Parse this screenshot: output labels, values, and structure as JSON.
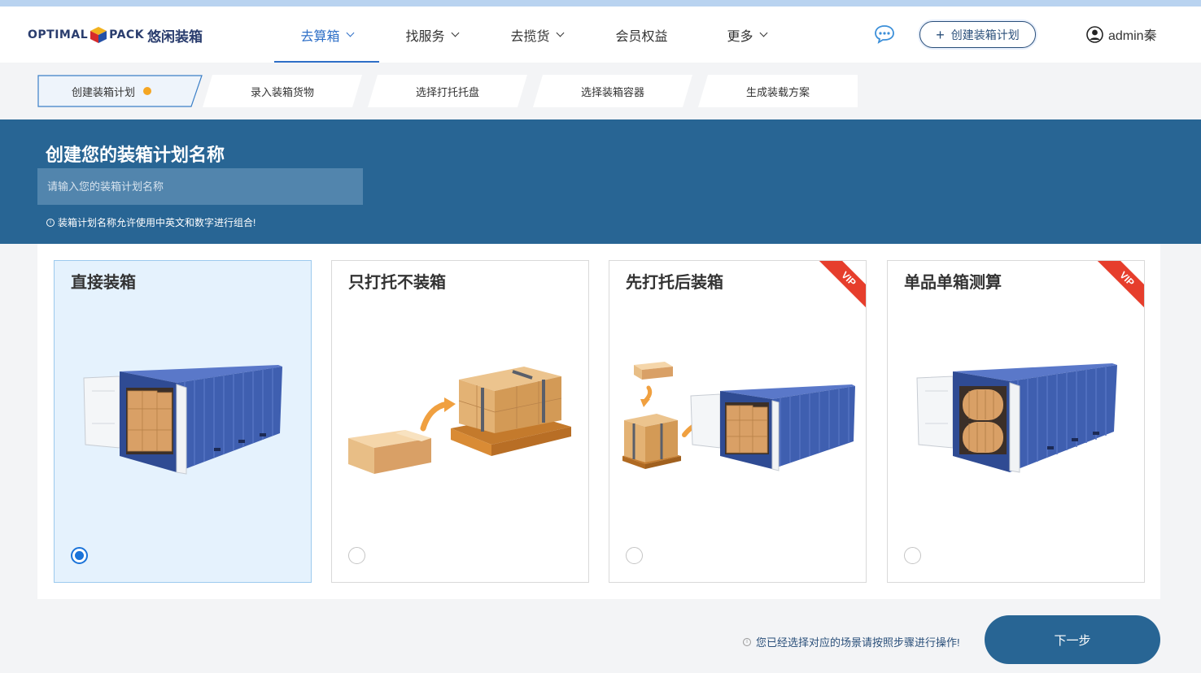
{
  "brand": {
    "logo_word_left": "Optimal",
    "logo_word_right": "Pack",
    "logo_cn": "悠闲装箱"
  },
  "nav": {
    "items": [
      {
        "label": "去算箱",
        "dropdown": true,
        "active": true
      },
      {
        "label": "找服务",
        "dropdown": true
      },
      {
        "label": "去揽货",
        "dropdown": true
      },
      {
        "label": "会员权益",
        "dropdown": false
      },
      {
        "label": "更多",
        "dropdown": true
      }
    ]
  },
  "header": {
    "create_button": "创建装箱计划",
    "user_name": "admin秦"
  },
  "steps": [
    "创建装箱计划",
    "录入装箱货物",
    "选择打托托盘",
    "选择装箱容器",
    "生成装载方案"
  ],
  "banner": {
    "title": "创建您的装箱计划名称",
    "input_placeholder": "请输入您的装箱计划名称",
    "input_value": "",
    "hint": "装箱计划名称允许使用中英文和数字进行组合!"
  },
  "cards": [
    {
      "title": "直接装箱",
      "selected": true,
      "vip": false
    },
    {
      "title": "只打托不装箱",
      "selected": false,
      "vip": false
    },
    {
      "title": "先打托后装箱",
      "selected": false,
      "vip": true
    },
    {
      "title": "单品单箱测算",
      "selected": false,
      "vip": true
    }
  ],
  "vip_label": "VIP",
  "footer": {
    "hint": "您已经选择对应的场景请按照步骤进行操作!",
    "next_button": "下一步"
  },
  "colors": {
    "primary": "#286594",
    "accent_blue": "#2e6fc7",
    "step_dot": "#f5a623",
    "vip_ribbon": "#e63e2c",
    "container_blue": "#3f5fb0",
    "box_brown": "#d9a066"
  }
}
